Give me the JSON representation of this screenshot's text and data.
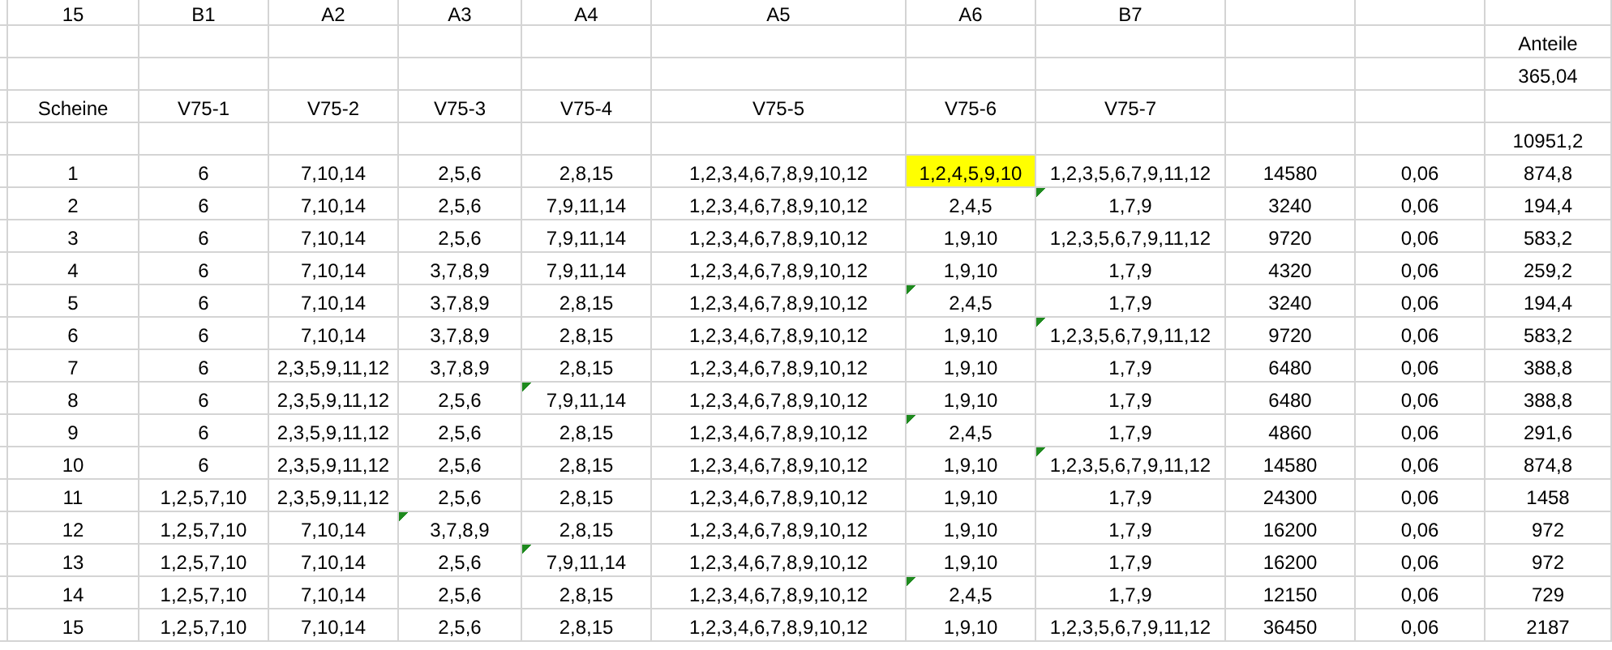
{
  "sheet": {
    "rows": [
      {
        "cells": [
          "15",
          "B1",
          "A2",
          "A3",
          "A4",
          "A5",
          "A6",
          "B7",
          null,
          null,
          null
        ]
      },
      {
        "cells": [
          null,
          null,
          null,
          null,
          null,
          null,
          null,
          null,
          null,
          null,
          "Anteile"
        ]
      },
      {
        "cells": [
          null,
          null,
          null,
          null,
          null,
          null,
          null,
          null,
          null,
          null,
          "365,04"
        ]
      },
      {
        "cells": [
          "Scheine",
          "V75-1",
          "V75-2",
          "V75-3",
          "V75-4",
          "V75-5",
          "V75-6",
          "V75-7",
          null,
          null,
          null
        ]
      },
      {
        "cells": [
          null,
          null,
          null,
          null,
          null,
          null,
          null,
          null,
          null,
          null,
          "10951,2"
        ]
      },
      {
        "cells": [
          "1",
          "6",
          "7,10,14",
          "2,5,6",
          "2,8,15",
          "1,2,3,4,6,7,8,9,10,12",
          "1,2,4,5,9,10",
          "1,2,3,5,6,7,9,11,12",
          "14580",
          "0,06",
          "874,8"
        ],
        "warnings": [
          false,
          false,
          false,
          false,
          false,
          false,
          false,
          false,
          false,
          false,
          false
        ],
        "highlighted": [
          false,
          false,
          false,
          false,
          false,
          false,
          true,
          false,
          false,
          false,
          false
        ]
      },
      {
        "cells": [
          "2",
          "6",
          "7,10,14",
          "2,5,6",
          "7,9,11,14",
          "1,2,3,4,6,7,8,9,10,12",
          "2,4,5",
          "1,7,9",
          "3240",
          "0,06",
          "194,4"
        ],
        "warnings": [
          false,
          false,
          false,
          false,
          false,
          false,
          false,
          true,
          false,
          false,
          false
        ],
        "highlighted": [
          false,
          false,
          false,
          false,
          false,
          false,
          false,
          false,
          false,
          false,
          false
        ]
      },
      {
        "cells": [
          "3",
          "6",
          "7,10,14",
          "2,5,6",
          "7,9,11,14",
          "1,2,3,4,6,7,8,9,10,12",
          "1,9,10",
          "1,2,3,5,6,7,9,11,12",
          "9720",
          "0,06",
          "583,2"
        ],
        "warnings": [
          false,
          false,
          false,
          false,
          false,
          false,
          false,
          false,
          false,
          false,
          false
        ],
        "highlighted": [
          false,
          false,
          false,
          false,
          false,
          false,
          false,
          false,
          false,
          false,
          false
        ]
      },
      {
        "cells": [
          "4",
          "6",
          "7,10,14",
          "3,7,8,9",
          "7,9,11,14",
          "1,2,3,4,6,7,8,9,10,12",
          "1,9,10",
          "1,7,9",
          "4320",
          "0,06",
          "259,2"
        ],
        "warnings": [
          false,
          false,
          false,
          false,
          false,
          false,
          false,
          false,
          false,
          false,
          false
        ],
        "highlighted": [
          false,
          false,
          false,
          false,
          false,
          false,
          false,
          false,
          false,
          false,
          false
        ]
      },
      {
        "cells": [
          "5",
          "6",
          "7,10,14",
          "3,7,8,9",
          "2,8,15",
          "1,2,3,4,6,7,8,9,10,12",
          "2,4,5",
          "1,7,9",
          "3240",
          "0,06",
          "194,4"
        ],
        "warnings": [
          false,
          false,
          false,
          false,
          false,
          false,
          true,
          false,
          false,
          false,
          false
        ],
        "highlighted": [
          false,
          false,
          false,
          false,
          false,
          false,
          false,
          false,
          false,
          false,
          false
        ]
      },
      {
        "cells": [
          "6",
          "6",
          "7,10,14",
          "3,7,8,9",
          "2,8,15",
          "1,2,3,4,6,7,8,9,10,12",
          "1,9,10",
          "1,2,3,5,6,7,9,11,12",
          "9720",
          "0,06",
          "583,2"
        ],
        "warnings": [
          false,
          false,
          false,
          false,
          false,
          false,
          false,
          true,
          false,
          false,
          false
        ],
        "highlighted": [
          false,
          false,
          false,
          false,
          false,
          false,
          false,
          false,
          false,
          false,
          false
        ]
      },
      {
        "cells": [
          "7",
          "6",
          "2,3,5,9,11,12",
          "3,7,8,9",
          "2,8,15",
          "1,2,3,4,6,7,8,9,10,12",
          "1,9,10",
          "1,7,9",
          "6480",
          "0,06",
          "388,8"
        ],
        "warnings": [
          false,
          false,
          false,
          false,
          false,
          false,
          false,
          false,
          false,
          false,
          false
        ],
        "highlighted": [
          false,
          false,
          false,
          false,
          false,
          false,
          false,
          false,
          false,
          false,
          false
        ]
      },
      {
        "cells": [
          "8",
          "6",
          "2,3,5,9,11,12",
          "2,5,6",
          "7,9,11,14",
          "1,2,3,4,6,7,8,9,10,12",
          "1,9,10",
          "1,7,9",
          "6480",
          "0,06",
          "388,8"
        ],
        "warnings": [
          false,
          false,
          false,
          false,
          true,
          false,
          false,
          false,
          false,
          false,
          false
        ],
        "highlighted": [
          false,
          false,
          false,
          false,
          false,
          false,
          false,
          false,
          false,
          false,
          false
        ]
      },
      {
        "cells": [
          "9",
          "6",
          "2,3,5,9,11,12",
          "2,5,6",
          "2,8,15",
          "1,2,3,4,6,7,8,9,10,12",
          "2,4,5",
          "1,7,9",
          "4860",
          "0,06",
          "291,6"
        ],
        "warnings": [
          false,
          false,
          false,
          false,
          false,
          false,
          true,
          false,
          false,
          false,
          false
        ],
        "highlighted": [
          false,
          false,
          false,
          false,
          false,
          false,
          false,
          false,
          false,
          false,
          false
        ]
      },
      {
        "cells": [
          "10",
          "6",
          "2,3,5,9,11,12",
          "2,5,6",
          "2,8,15",
          "1,2,3,4,6,7,8,9,10,12",
          "1,9,10",
          "1,2,3,5,6,7,9,11,12",
          "14580",
          "0,06",
          "874,8"
        ],
        "warnings": [
          false,
          false,
          false,
          false,
          false,
          false,
          false,
          true,
          false,
          false,
          false
        ],
        "highlighted": [
          false,
          false,
          false,
          false,
          false,
          false,
          false,
          false,
          false,
          false,
          false
        ]
      },
      {
        "cells": [
          "11",
          "1,2,5,7,10",
          "2,3,5,9,11,12",
          "2,5,6",
          "2,8,15",
          "1,2,3,4,6,7,8,9,10,12",
          "1,9,10",
          "1,7,9",
          "24300",
          "0,06",
          "1458"
        ],
        "warnings": [
          false,
          false,
          false,
          false,
          false,
          false,
          false,
          false,
          false,
          false,
          false
        ],
        "highlighted": [
          false,
          false,
          false,
          false,
          false,
          false,
          false,
          false,
          false,
          false,
          false
        ]
      },
      {
        "cells": [
          "12",
          "1,2,5,7,10",
          "7,10,14",
          "3,7,8,9",
          "2,8,15",
          "1,2,3,4,6,7,8,9,10,12",
          "1,9,10",
          "1,7,9",
          "16200",
          "0,06",
          "972"
        ],
        "warnings": [
          false,
          false,
          false,
          true,
          false,
          false,
          false,
          false,
          false,
          false,
          false
        ],
        "highlighted": [
          false,
          false,
          false,
          false,
          false,
          false,
          false,
          false,
          false,
          false,
          false
        ]
      },
      {
        "cells": [
          "13",
          "1,2,5,7,10",
          "7,10,14",
          "2,5,6",
          "7,9,11,14",
          "1,2,3,4,6,7,8,9,10,12",
          "1,9,10",
          "1,7,9",
          "16200",
          "0,06",
          "972"
        ],
        "warnings": [
          false,
          false,
          false,
          false,
          true,
          false,
          false,
          false,
          false,
          false,
          false
        ],
        "highlighted": [
          false,
          false,
          false,
          false,
          false,
          false,
          false,
          false,
          false,
          false,
          false
        ]
      },
      {
        "cells": [
          "14",
          "1,2,5,7,10",
          "7,10,14",
          "2,5,6",
          "2,8,15",
          "1,2,3,4,6,7,8,9,10,12",
          "2,4,5",
          "1,7,9",
          "12150",
          "0,06",
          "729"
        ],
        "warnings": [
          false,
          false,
          false,
          false,
          false,
          false,
          true,
          false,
          false,
          false,
          false
        ],
        "highlighted": [
          false,
          false,
          false,
          false,
          false,
          false,
          false,
          false,
          false,
          false,
          false
        ]
      },
      {
        "cells": [
          "15",
          "1,2,5,7,10",
          "7,10,14",
          "2,5,6",
          "2,8,15",
          "1,2,3,4,6,7,8,9,10,12",
          "1,9,10",
          "1,2,3,5,6,7,9,11,12",
          "36450",
          "0,06",
          "2187"
        ],
        "warnings": [
          false,
          false,
          false,
          false,
          false,
          false,
          false,
          false,
          false,
          false,
          false
        ],
        "highlighted": [
          false,
          false,
          false,
          false,
          false,
          false,
          false,
          false,
          false,
          false,
          false
        ]
      }
    ]
  }
}
